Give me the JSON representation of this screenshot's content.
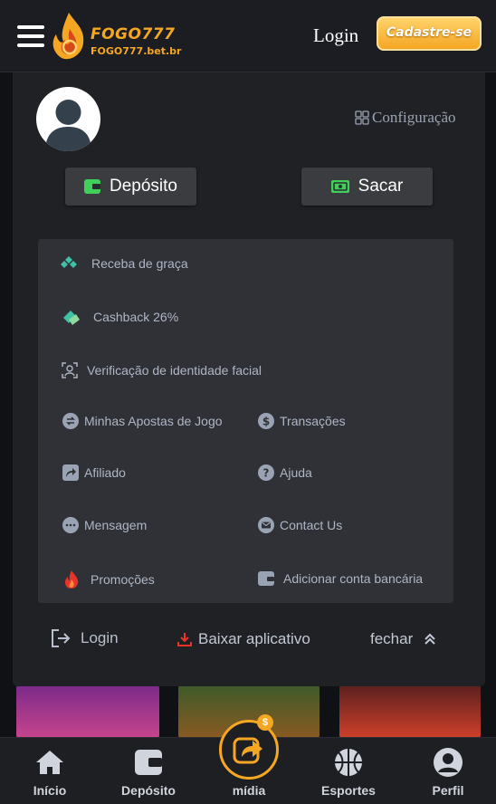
{
  "header": {
    "logo_text": "FOGO777",
    "logo_domain": "FOGO777.bet.br",
    "login_label": "Login",
    "register_label": "Cadastre-se"
  },
  "profile": {
    "config_label": "Configuração",
    "deposit_label": "Depósito",
    "withdraw_label": "Sacar"
  },
  "menu": {
    "free": "Receba de graça",
    "cashback": "Cashback 26%",
    "face_verify": "Verificação de identidade facial",
    "my_bets": "Minhas Apostas de Jogo",
    "transactions": "Transações",
    "affiliate": "Afiliado",
    "help": "Ajuda",
    "message": "Mensagem",
    "contact": "Contact Us",
    "promotions": "Promoções",
    "add_bank": "Adicionar conta bancária"
  },
  "footer": {
    "login": "Login",
    "download": "Baixar aplicativo",
    "close": "fechar"
  },
  "bottom_nav": {
    "home": "Início",
    "deposit": "Depósito",
    "media": "mídia",
    "media_badge": "$",
    "sports": "Esportes",
    "profile": "Perfil"
  },
  "colors": {
    "accent": "#f5a623",
    "panel": "#202124",
    "menu_bg": "#2f3136",
    "icon_teal": "#3fc1a6",
    "icon_red": "#e8332a"
  }
}
